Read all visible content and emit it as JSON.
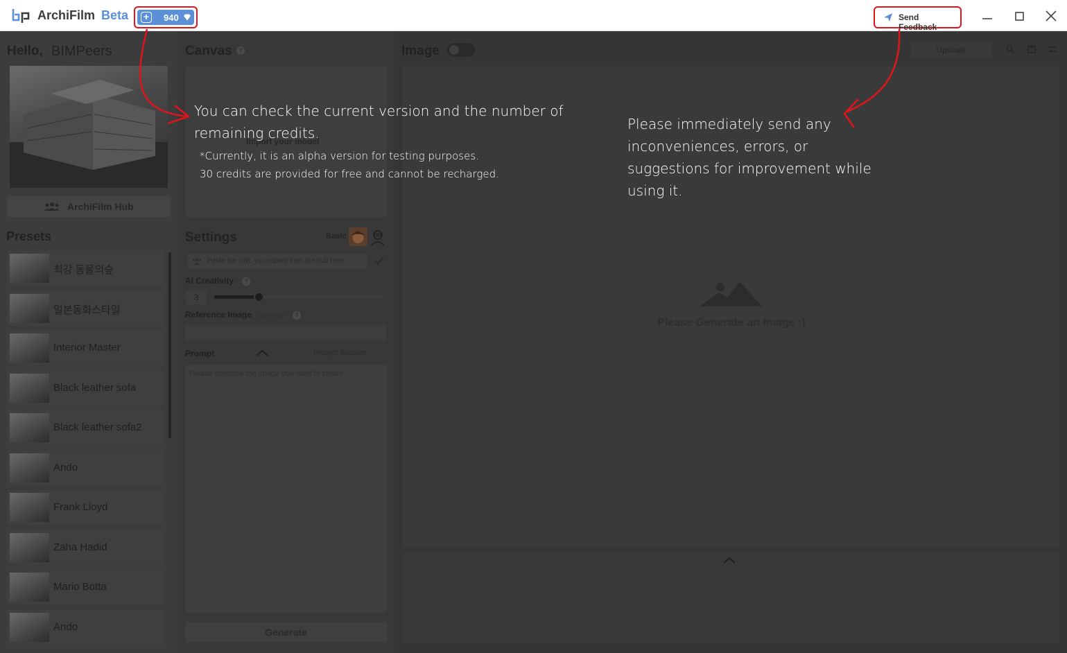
{
  "header": {
    "app_name": "ArchiFilm",
    "version_tag": "Beta",
    "credits": "940",
    "feedback_label": "Send Feedback"
  },
  "sidebar": {
    "greeting": "Hello,",
    "user_name": "BIMPeers",
    "hub_label": "ArchiFilm Hub",
    "presets_title": "Presets",
    "presets": [
      {
        "label": "최강 동물의숲"
      },
      {
        "label": "일본동화스타일"
      },
      {
        "label": "Interior Master"
      },
      {
        "label": "Black leather sofa"
      },
      {
        "label": "Black leather sofa2"
      },
      {
        "label": "Ando"
      },
      {
        "label": "Frank Lloyd"
      },
      {
        "label": "Zaha Hadid"
      },
      {
        "label": "Mario Botta"
      },
      {
        "label": "Ando"
      }
    ]
  },
  "canvas": {
    "title": "Canvas",
    "help": "?",
    "import_label": "Import your model"
  },
  "settings": {
    "title": "Settings",
    "mode_label": "Basic",
    "url_placeholder": "Paste the URL you copied from the hub here",
    "creativity_label": "AI Creativity",
    "creativity_value": "3",
    "creativity_level": 0.3,
    "help": "?",
    "reference_label": "Reference Image",
    "reference_optional": "(Optional)",
    "reference_dots": "...",
    "prompt_label": "Prompt",
    "booster_label": "Prompt Booster",
    "prompt_placeholder": "Please describe the image you want to create.",
    "generate_label": "Generate"
  },
  "image": {
    "title": "Image",
    "upscale_label": "Upscale",
    "placeholder_text": "Please Generate an Image :)"
  },
  "annotations": {
    "credit_note_line1": "You can check the current version and the number of remaining credits.",
    "credit_note_line2": "*Currently, it is an alpha version for testing purposes.",
    "credit_note_line3": "30 credits are provided for free and cannot be recharged.",
    "feedback_note": "Please immediately send any inconveniences, errors, or suggestions for improvement while using it."
  },
  "colors": {
    "accent": "#5b8fd6",
    "annotation": "#e0151b"
  },
  "icons": {
    "logo": "bp-logo-icon",
    "credit_plus": "plus-square-icon",
    "credit_gem": "gem-icon",
    "feedback": "paper-plane-icon",
    "hub": "users-icon",
    "check": "check-icon",
    "search": "search-icon",
    "save": "save-icon",
    "settings": "sliders-icon",
    "placeholder": "mountain-image-icon"
  }
}
